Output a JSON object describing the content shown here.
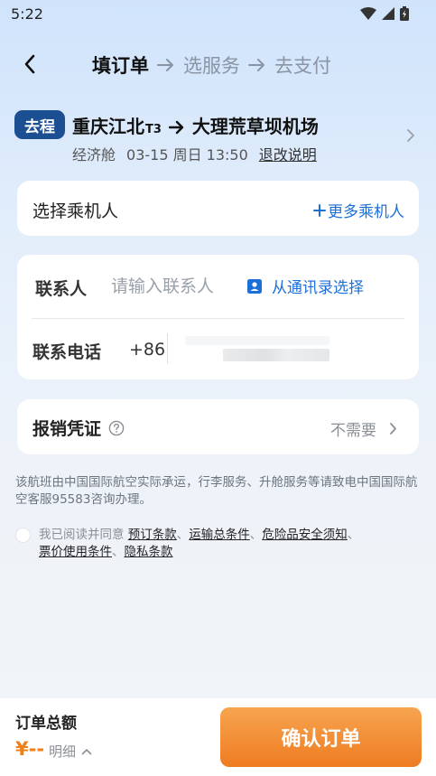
{
  "status_bar": {
    "time": "5:22"
  },
  "nav": {
    "steps": [
      "填订单",
      "选服务",
      "去支付"
    ]
  },
  "flight": {
    "trip_badge": "去程",
    "origin": "重庆江北",
    "origin_terminal": "T3",
    "destination": "大理荒草坝机场",
    "cabin": "经济舱",
    "datetime": "03-15 周日 13:50",
    "refund_link": "退改说明"
  },
  "passenger": {
    "title": "选择乘机人",
    "more_button": "更多乘机人"
  },
  "contact": {
    "name_label": "联系人",
    "name_placeholder": "请输入联系人",
    "addressbook_button": "从通讯录选择",
    "phone_label": "联系电话",
    "country_code": "+86"
  },
  "invoice": {
    "title": "报销凭证",
    "value": "不需要"
  },
  "notice": "该航班由中国国际航空实际承运，行李服务、升舱服务等请致电中国国际航空客服95583咨询办理。",
  "agreement": {
    "prefix": "我已阅读并同意",
    "links": [
      "预订条款",
      "运输总条件",
      "危险品安全须知",
      "票价使用条件",
      "隐私条款"
    ],
    "separator": "、"
  },
  "bottom": {
    "total_label": "订单总额",
    "total_amount": "¥--",
    "detail_label": "明细",
    "confirm_button": "确认订单"
  },
  "colors": {
    "accent_blue": "#1d6fd8",
    "badge_navy": "#1b4f91",
    "confirm_orange": "#ee7c22",
    "price_orange": "#f07f1a"
  }
}
